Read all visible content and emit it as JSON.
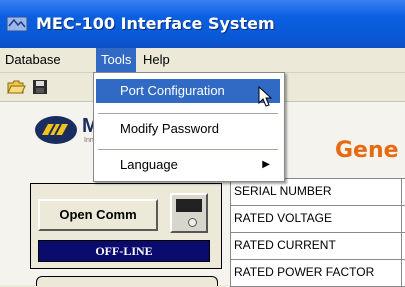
{
  "window": {
    "title": "MEC-100 Interface System"
  },
  "menubar": {
    "items": [
      {
        "label": "Database"
      },
      {
        "label": "Tools"
      },
      {
        "label": "Help"
      }
    ]
  },
  "tools_menu": {
    "port_configuration": "Port Configuration",
    "modify_password": "Modify Password",
    "language": "Language"
  },
  "logo": {
    "text": "Ma",
    "subtext": "Innov"
  },
  "heading": "Gene",
  "comm": {
    "open_label": "Open Comm",
    "status": "OFF-LINE"
  },
  "grid": {
    "rows": [
      "SERIAL NUMBER",
      "RATED VOLTAGE",
      "RATED CURRENT",
      "RATED POWER FACTOR"
    ]
  },
  "colors": {
    "title_bar": "#0a58d6",
    "menu_highlight": "#316ac5",
    "heading": "#e86a10",
    "offline_bg": "#0b0b6e"
  }
}
